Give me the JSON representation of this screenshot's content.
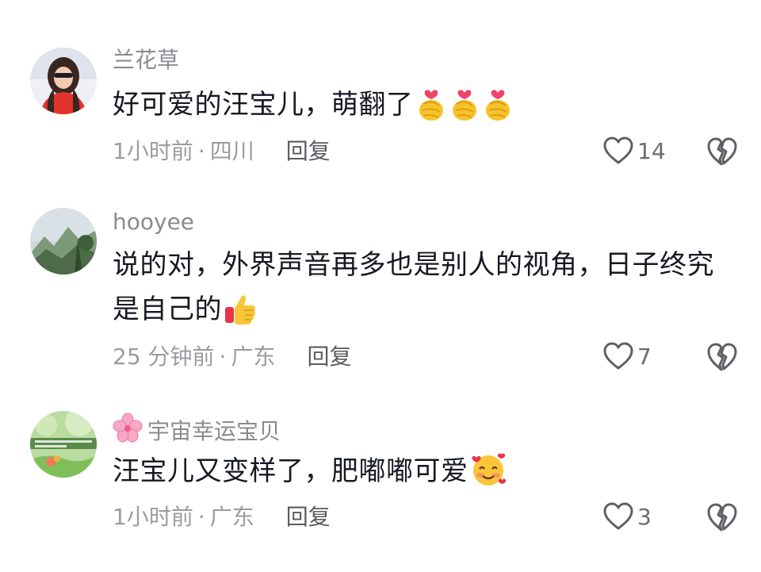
{
  "comments": [
    {
      "username": "兰花草",
      "text": "好可爱的汪宝儿，萌翻了",
      "emoji_icons": [
        "finger-heart-icon",
        "finger-heart-icon",
        "finger-heart-icon"
      ],
      "time": "1小时前",
      "location": "四川",
      "reply_label": "回复",
      "likes": "14"
    },
    {
      "username": "hooyee",
      "text_line1": "说的对，外界声音再多也是别人的视角，日子终究",
      "text_line2": "是自己的",
      "emoji_icons": [
        "thumbs-up-icon"
      ],
      "time": "25 分钟前",
      "location": "广东",
      "reply_label": "回复",
      "likes": "7"
    },
    {
      "username": "宇宙幸运宝贝",
      "username_icon": "cherry-blossom-icon",
      "text": "汪宝儿又变样了，肥嘟嘟可爱",
      "emoji_icons": [
        "smiling-face-with-hearts-icon"
      ],
      "time": "1小时前",
      "location": "广东",
      "reply_label": "回复",
      "likes": "3"
    }
  ],
  "separator": "·",
  "colors": {
    "text": "#161823",
    "meta": "#9b9ca2",
    "username": "#8a8b91",
    "icon": "#6b6c72"
  }
}
